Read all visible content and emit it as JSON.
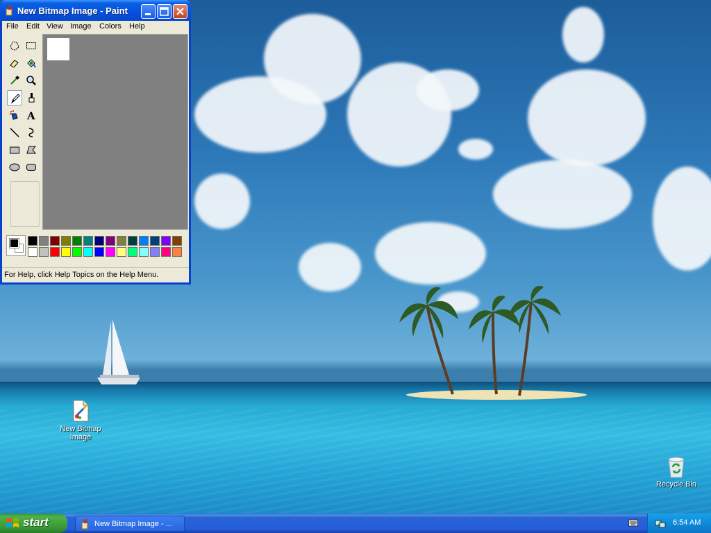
{
  "window": {
    "title": "New Bitmap Image - Paint",
    "menu": [
      "File",
      "Edit",
      "View",
      "Image",
      "Colors",
      "Help"
    ],
    "status_text": "For Help, click Help Topics on the Help Menu.",
    "tools": [
      {
        "name": "free-form-select",
        "active": false
      },
      {
        "name": "select",
        "active": false
      },
      {
        "name": "eraser",
        "active": false
      },
      {
        "name": "fill-with-color",
        "active": false
      },
      {
        "name": "pick-color",
        "active": false
      },
      {
        "name": "magnifier",
        "active": false
      },
      {
        "name": "pencil",
        "active": true
      },
      {
        "name": "brush",
        "active": false
      },
      {
        "name": "airbrush",
        "active": false
      },
      {
        "name": "text",
        "active": false
      },
      {
        "name": "line",
        "active": false
      },
      {
        "name": "curve",
        "active": false
      },
      {
        "name": "rectangle",
        "active": false
      },
      {
        "name": "polygon",
        "active": false
      },
      {
        "name": "ellipse",
        "active": false
      },
      {
        "name": "rounded-rectangle",
        "active": false
      }
    ],
    "colors": {
      "foreground": "#000000",
      "background": "#ffffff",
      "palette_row1": [
        "#000000",
        "#808080",
        "#800000",
        "#808000",
        "#008000",
        "#008080",
        "#000080",
        "#800080",
        "#808040",
        "#004040",
        "#0080ff",
        "#004080",
        "#8000ff",
        "#804000"
      ],
      "palette_row2": [
        "#ffffff",
        "#c0c0c0",
        "#ff0000",
        "#ffff00",
        "#00ff00",
        "#00ffff",
        "#0000ff",
        "#ff00ff",
        "#ffff80",
        "#00ff80",
        "#80ffff",
        "#8080ff",
        "#ff0080",
        "#ff8040"
      ]
    }
  },
  "desktop": {
    "icons": [
      {
        "label_line1": "New Bitmap",
        "label_line2": "Image"
      },
      {
        "label_line1": "Recycle Bin"
      }
    ]
  },
  "taskbar": {
    "start_label": "start",
    "task_label": "New Bitmap Image - ...",
    "clock": "6:54 AM"
  }
}
